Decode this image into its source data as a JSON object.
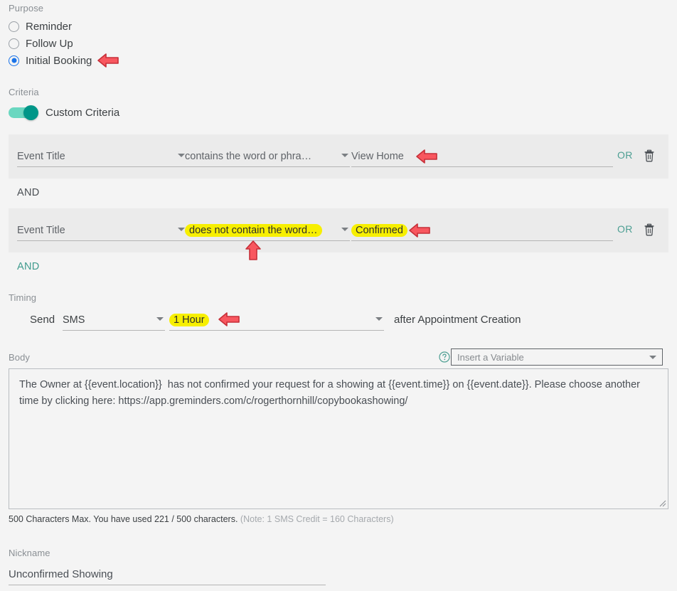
{
  "purpose": {
    "label": "Purpose",
    "options": [
      {
        "label": "Reminder",
        "selected": false
      },
      {
        "label": "Follow Up",
        "selected": false
      },
      {
        "label": "Initial Booking",
        "selected": true
      }
    ]
  },
  "criteria": {
    "label": "Criteria",
    "toggle_label": "Custom Criteria",
    "rows": [
      {
        "field": "Event Title",
        "operator": "contains the word or phra…",
        "value": "View Home",
        "or_label": "OR",
        "delete_icon": "trash-icon"
      },
      {
        "field": "Event Title",
        "operator": "does not contain the word…",
        "value": "Confirmed",
        "or_label": "OR",
        "delete_icon": "trash-icon"
      }
    ],
    "and_separator": "AND",
    "and_add": "AND"
  },
  "timing": {
    "label": "Timing",
    "send_label": "Send",
    "channel": "SMS",
    "offset": "1 Hour",
    "relative": "after Appointment Creation"
  },
  "body": {
    "label": "Body",
    "help_icon": "help-circle-icon",
    "variable_placeholder": "Insert a Variable",
    "text": "The Owner at {{event.location}}  has not confirmed your request for a showing at {{event.time}} on {{event.date}}. Please choose another time by clicking here: https://app.greminders.com/c/rogerthornhill/copybookashowing/",
    "counter_main": "500 Characters Max. You have used 221 / 500 characters.",
    "counter_note": "(Note: 1 SMS Credit = 160 Characters)"
  },
  "nickname": {
    "label": "Nickname",
    "value": "Unconfirmed Showing"
  },
  "colors": {
    "accent_teal": "#009688",
    "radio_blue": "#1a73e8",
    "highlight_yellow": "#f7ef00",
    "annotation_red": "#f8575f",
    "row_bg": "#ebebeb",
    "page_bg": "#f4f4f4"
  },
  "annotations": [
    {
      "name": "arrow-initial-booking",
      "direction": "left"
    },
    {
      "name": "arrow-criteria-value-1",
      "direction": "left"
    },
    {
      "name": "arrow-criteria-operator-2",
      "direction": "up"
    },
    {
      "name": "arrow-criteria-value-2",
      "direction": "left"
    },
    {
      "name": "arrow-timing-offset",
      "direction": "left"
    }
  ]
}
